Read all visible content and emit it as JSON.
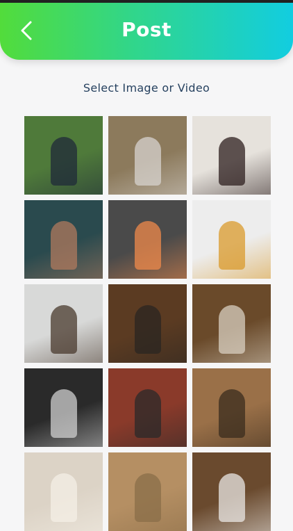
{
  "header": {
    "title": "Post",
    "back_icon": "chevron-left-icon",
    "gradient_start": "#52dc3b",
    "gradient_end": "#12cde0"
  },
  "prompt": "Select Image or Video",
  "gallery": {
    "items": [
      {
        "name": "image-woman-garden",
        "bg": "#4f7a3a",
        "accent": "#1f2a3a"
      },
      {
        "name": "image-woman-sweater-sunset",
        "bg": "#8c7a5c",
        "accent": "#d7d3cf"
      },
      {
        "name": "image-woman-window-floor",
        "bg": "#e6e2dc",
        "accent": "#2d1f1f"
      },
      {
        "name": "image-hand-necklace",
        "bg": "#2a4a4e",
        "accent": "#b07a5e"
      },
      {
        "name": "image-sushi-tray",
        "bg": "#4a4a4a",
        "accent": "#f08a4b"
      },
      {
        "name": "image-vase-sunflowers",
        "bg": "#ededed",
        "accent": "#d99a2b"
      },
      {
        "name": "image-man-vest-wall",
        "bg": "#d8d9d8",
        "accent": "#4a3a2e"
      },
      {
        "name": "image-owl",
        "bg": "#5b3b22",
        "accent": "#2a2622"
      },
      {
        "name": "image-hedgehog",
        "bg": "#6a4a2a",
        "accent": "#d8cfc0"
      },
      {
        "name": "image-spiral-stairs",
        "bg": "#2a2a2a",
        "accent": "#cfcfcf"
      },
      {
        "name": "image-woman-brick-wall",
        "bg": "#8a3a2a",
        "accent": "#2a2a2a"
      },
      {
        "name": "image-stone-window",
        "bg": "#9a7048",
        "accent": "#3a2c1e"
      },
      {
        "name": "image-candle-magazine",
        "bg": "#dcd3c6",
        "accent": "#f4efe6"
      },
      {
        "name": "image-hands-dress",
        "bg": "#b58f63",
        "accent": "#8a6d48"
      },
      {
        "name": "image-woman-beanie-cafe",
        "bg": "#6a4a2e",
        "accent": "#e9e7e4"
      }
    ]
  }
}
